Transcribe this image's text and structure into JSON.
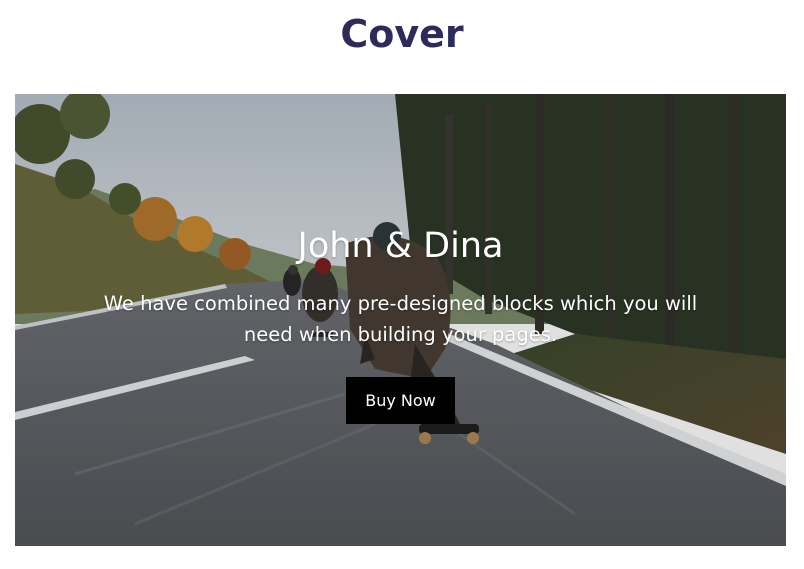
{
  "section": {
    "title": "Cover"
  },
  "cover": {
    "heading": "John & Dina",
    "text": "We have combined many pre-designed blocks which you will need when building your pages.",
    "button_label": "Buy Now",
    "image_subject": "longboard riders downhill on forest road"
  },
  "colors": {
    "title": "#2e2a5a",
    "button_bg": "#000000",
    "overlay_text": "#ffffff"
  }
}
